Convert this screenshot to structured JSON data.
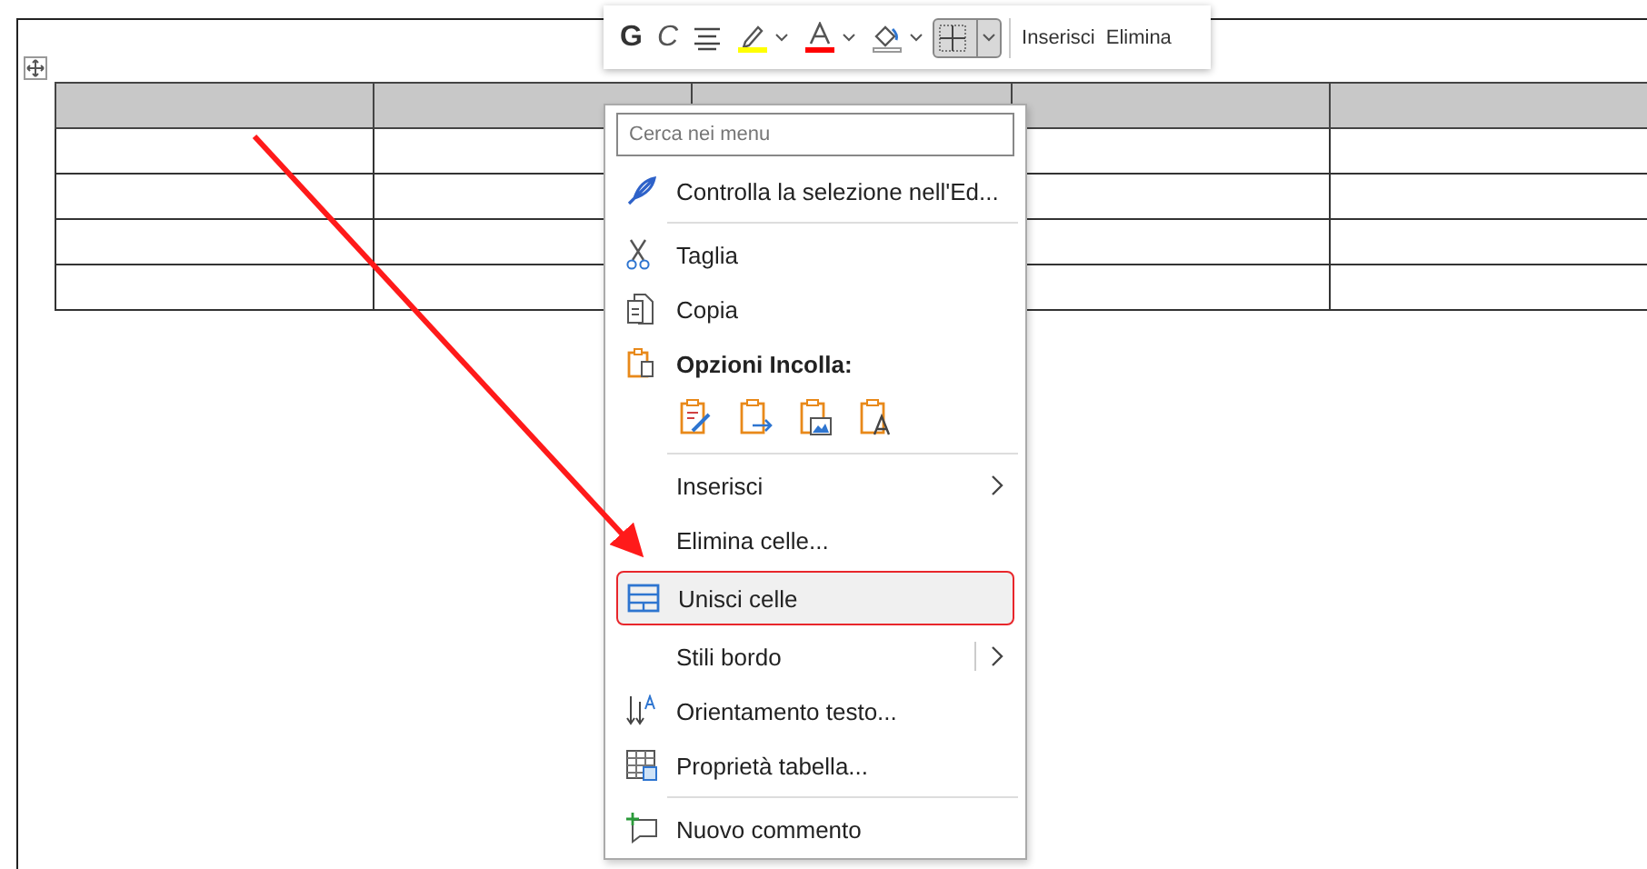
{
  "toolbar": {
    "items": [
      {
        "kind": "bold",
        "label": "G",
        "selected": false
      },
      {
        "kind": "italic",
        "label": "C",
        "selected": false
      },
      {
        "kind": "align",
        "selected": false
      },
      {
        "kind": "highlight",
        "color": "#ffff00",
        "selected": false
      },
      {
        "kind": "fontcolor",
        "color": "#ff0000",
        "selected": false
      },
      {
        "kind": "shading",
        "selected": false
      },
      {
        "kind": "borders",
        "selected": true
      },
      {
        "kind": "text",
        "label": "Inserisci",
        "selected": false
      },
      {
        "kind": "text",
        "label": "Elimina",
        "selected": false
      }
    ]
  },
  "table": {
    "rows": [
      {
        "kind": "header"
      },
      {
        "kind": "body"
      },
      {
        "kind": "body"
      },
      {
        "kind": "body"
      },
      {
        "kind": "body"
      }
    ]
  },
  "context_menu": {
    "search": {
      "placeholder": "Cerca nei menu"
    },
    "items": [
      {
        "kind": "item",
        "label": "Controlla la selezione nell'Ed...",
        "selected": false,
        "submenu": false
      },
      {
        "kind": "separator"
      },
      {
        "kind": "item",
        "label": "Taglia",
        "selected": false,
        "submenu": false
      },
      {
        "kind": "item",
        "label": "Copia",
        "selected": false,
        "submenu": false
      },
      {
        "kind": "heading",
        "label": "Opzioni Incolla:"
      },
      {
        "kind": "paste-options"
      },
      {
        "kind": "separator"
      },
      {
        "kind": "item",
        "label": "Inserisci",
        "selected": false,
        "submenu": true
      },
      {
        "kind": "item",
        "label": "Elimina celle...",
        "selected": false,
        "submenu": false
      },
      {
        "kind": "item",
        "label": "Unisci celle",
        "selected": true,
        "submenu": false
      },
      {
        "kind": "item",
        "label": "Stili bordo",
        "selected": false,
        "submenu": true
      },
      {
        "kind": "item",
        "label": "Orientamento testo...",
        "selected": false,
        "submenu": false
      },
      {
        "kind": "item",
        "label": "Proprietà tabella...",
        "selected": false,
        "submenu": false
      },
      {
        "kind": "separator"
      },
      {
        "kind": "item",
        "label": "Nuovo commento",
        "selected": false,
        "submenu": false
      }
    ]
  }
}
